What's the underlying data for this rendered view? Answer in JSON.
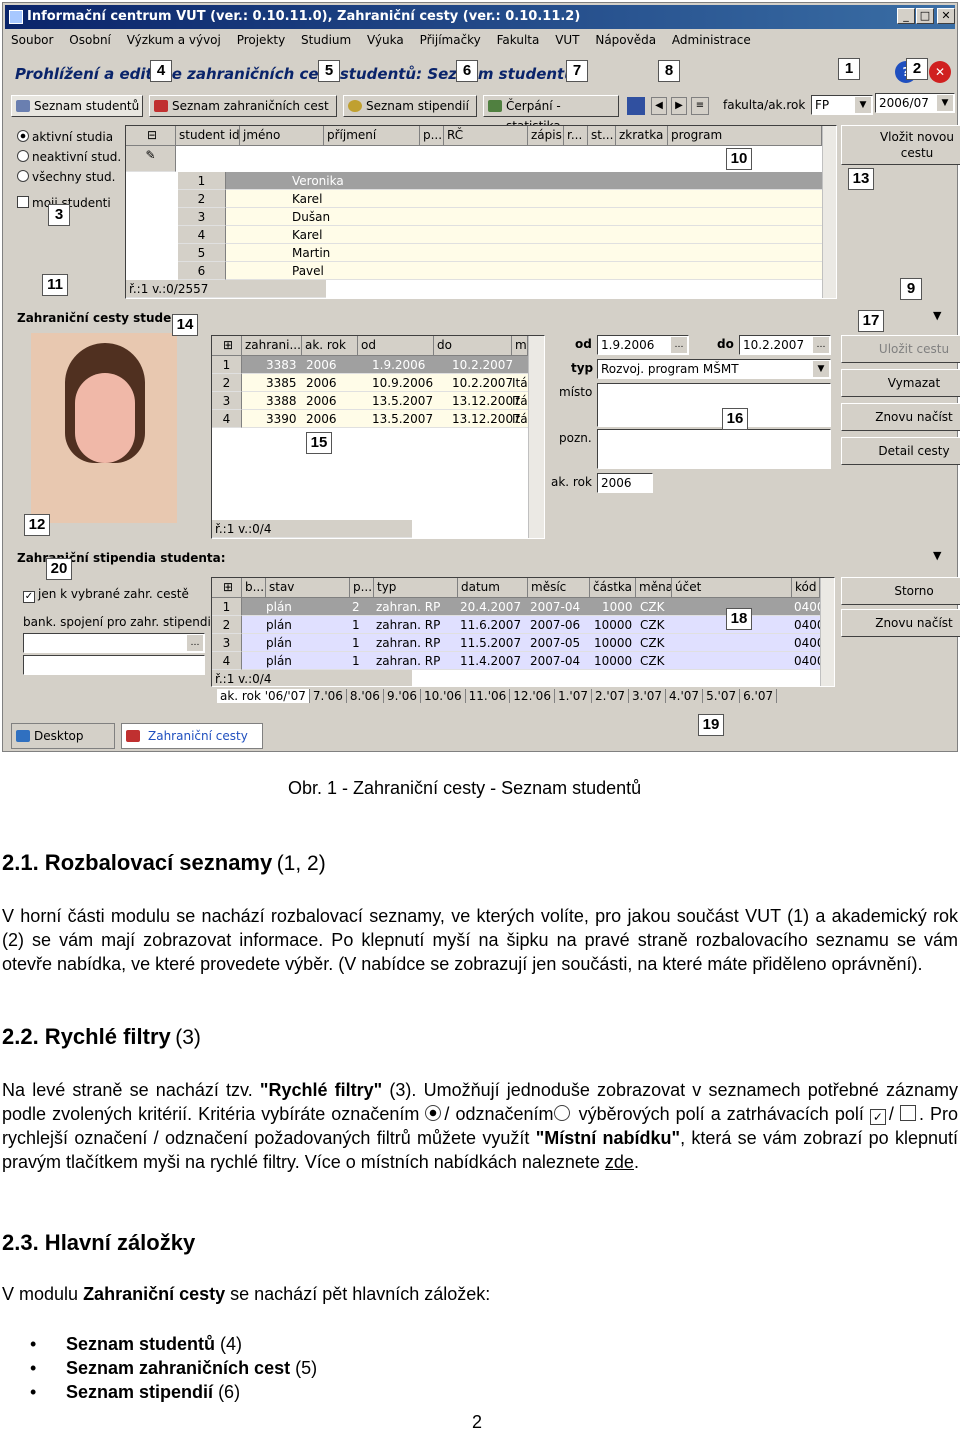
{
  "window": {
    "title": "Informační centrum VUT (ver.: 0.10.11.0), Zahraniční cesty (ver.: 0.10.11.2)",
    "menu": [
      "Soubor",
      "Osobní",
      "Výzkum a vývoj",
      "Projekty",
      "Studium",
      "Výuka",
      "Přijímačky",
      "Fakulta",
      "VUT",
      "Nápověda",
      "Administrace"
    ],
    "module_title": "Prohlížení a editace zahraničních cest studentů: Seznam studentů",
    "tabs": [
      "Seznam studentů",
      "Seznam zahraničních cest",
      "Seznam stipendií",
      "Čerpání - statistika"
    ],
    "faculty_label": "fakulta/ak.rok",
    "faculty_value": "FP",
    "year_value": "2006/07"
  },
  "filters": {
    "options": [
      "aktivní studia",
      "neaktivní stud.",
      "všechny stud.",
      "moji studenti"
    ]
  },
  "students": {
    "headers": [
      "student id",
      "jméno",
      "příjmení",
      "p...",
      "RČ",
      "zápis",
      "r...",
      "st...",
      "zkratka",
      "program"
    ],
    "row_numbers": [
      "1",
      "2",
      "3",
      "4",
      "5",
      "6"
    ],
    "names": [
      "Veronika",
      "Karel",
      "Dušan",
      "Karel",
      "Martin",
      "Pavel"
    ],
    "status": "ř.:1 v.:0/2557"
  },
  "side_buttons": {
    "insert": "Vložit novou cestu",
    "save": "Uložit cestu",
    "delete": "Vymazat",
    "reload": "Znovu načíst",
    "detail": "Detail cesty",
    "cancel": "Storno",
    "reload2": "Znovu načíst"
  },
  "trips": {
    "section_title": "Zahraniční cesty stude",
    "headers": [
      "zahrani...",
      "ak. rok",
      "od",
      "do",
      "m"
    ],
    "rows": [
      [
        "3383",
        "2006",
        "1.9.2006",
        "10.2.2007",
        ""
      ],
      [
        "3385",
        "2006",
        "10.9.2006",
        "10.2.2007",
        "Itá"
      ],
      [
        "3388",
        "2006",
        "13.5.2007",
        "13.12.2007",
        "Itá"
      ],
      [
        "3390",
        "2006",
        "13.5.2007",
        "13.12.2007",
        "Itá"
      ]
    ],
    "row_numbers": [
      "1",
      "2",
      "3",
      "4"
    ],
    "status": "ř.:1 v.:0/4"
  },
  "trip_detail": {
    "od_label": "od",
    "od_value": "1.9.2006",
    "do_label": "do",
    "do_value": "10.2.2007",
    "typ_label": "typ",
    "typ_value": "Rozvoj. program MŠMT",
    "misto_label": "místo",
    "pozn_label": "pozn.",
    "akrok_label": "ak. rok",
    "akrok_value": "2006"
  },
  "stipends": {
    "section_title": "Zahraniční stipendia studenta:",
    "only_label": "jen k vybrané zahr. cestě",
    "bank_label": "bank. spojení pro zahr. stipendia",
    "headers": [
      "b...",
      "stav",
      "p...",
      "typ",
      "datum",
      "měsíc",
      "částka",
      "měna",
      "účet",
      "kód"
    ],
    "rows": [
      [
        "plán",
        "2",
        "zahran. RP",
        "20.4.2007",
        "2007-04",
        "1000",
        "CZK",
        "0400"
      ],
      [
        "plán",
        "1",
        "zahran. RP",
        "11.6.2007",
        "2007-06",
        "10000",
        "CZK",
        "0400"
      ],
      [
        "plán",
        "1",
        "zahran. RP",
        "11.5.2007",
        "2007-05",
        "10000",
        "CZK",
        "0400"
      ],
      [
        "plán",
        "1",
        "zahran. RP",
        "11.4.2007",
        "2007-04",
        "10000",
        "CZK",
        "0400"
      ]
    ],
    "row_numbers": [
      "1",
      "2",
      "3",
      "4"
    ],
    "status": "ř.:1 v.:0/4",
    "month_tabs": [
      "ak. rok '06/'07",
      "7.'06",
      "8.'06",
      "9.'06",
      "10.'06",
      "11.'06",
      "12.'06",
      "1.'07",
      "2.'07",
      "3.'07",
      "4.'07",
      "5.'07",
      "6.'07"
    ]
  },
  "taskbar": [
    "Desktop",
    "Zahraniční cesty"
  ],
  "callouts": [
    "1",
    "2",
    "3",
    "4",
    "5",
    "6",
    "7",
    "8",
    "9",
    "10",
    "11",
    "12",
    "13",
    "14",
    "15",
    "16",
    "17",
    "18",
    "19",
    "20"
  ],
  "doc": {
    "caption": "Obr. 1 - Zahraniční cesty - Seznam studentů",
    "h1": "2.1. Rozbalovací seznamy",
    "h1_suffix": "(1, 2)",
    "p1": "V horní části modulu se nachází rozbalovací seznamy, ve kterých volíte, pro jakou součást VUT (1) a akademický rok (2) se vám mají zobrazovat informace. Po klepnutí myší na šipku na pravé straně rozbalovacího seznamu se vám otevře nabídka, ve které provedete výběr. (V nabídce se zobrazují jen součásti, na které máte přiděleno oprávnění).",
    "h2": "2.2. Rychlé filtry",
    "h2_suffix": "(3)",
    "p2a": "Na levé straně se nachází tzv.",
    "p2b": "\"Rychlé filtry\"",
    "p2c": "(3). Umožňují jednoduše zobrazovat v seznamech potřebné záznamy podle zvolených kritérií. Kritéria vybíráte označením",
    "p2d": "/ odznačením",
    "p2e": "výběrových polí a zatrhávacích polí",
    "p2f": "/",
    "p2g": ". Pro rychlejší označení / odznačení požadovaných filtrů můžete využít",
    "p2h": "\"Místní nabídku\"",
    "p2i": ", která se vám zobrazí po klepnutí pravým tlačítkem myši na rychlé filtry. Více o místních nabídkách naleznete",
    "p2j": "zde",
    "h3": "2.3. Hlavní záložky",
    "p3a": "V modulu",
    "p3b": "Zahraniční cesty",
    "p3c": "se nachází pět hlavních záložek:",
    "list": [
      {
        "b": "Seznam studentů",
        "s": "(4)"
      },
      {
        "b": "Seznam zahraničních cest",
        "s": "(5)"
      },
      {
        "b": "Seznam stipendií",
        "s": "(6)"
      }
    ],
    "page": "2"
  }
}
